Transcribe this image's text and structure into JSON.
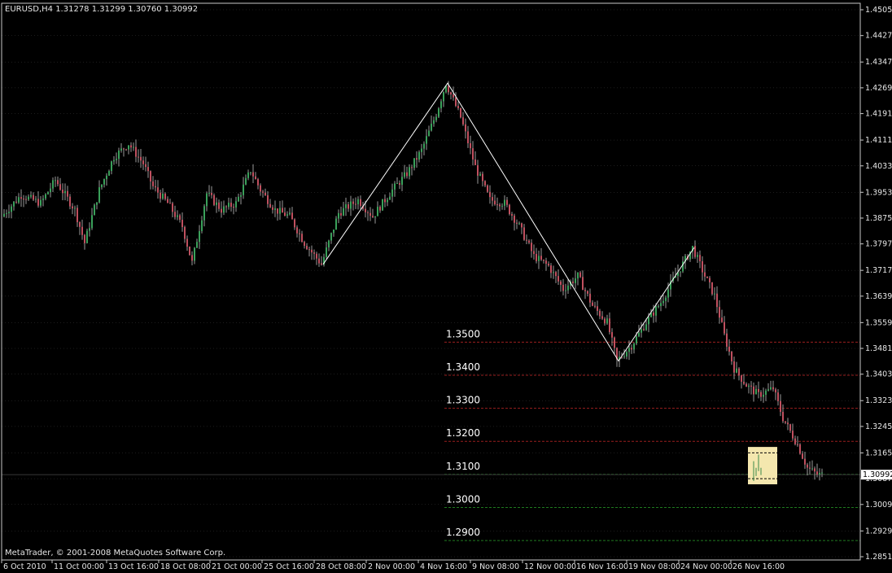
{
  "header": {
    "symbol_info": "EURUSD,H4  1.31278 1.31299 1.30760 1.30992"
  },
  "footer": {
    "copyright": "MetaTrader, © 2001-2008 MetaQuotes Software Corp."
  },
  "colors": {
    "background": "#000000",
    "frame": "#c8c8c8",
    "grid": "#3a3a3a",
    "candle_up": "#3aa05a",
    "candle_down": "#c0505f",
    "wick": "#9a9a9a",
    "zigzag": "#ffffff",
    "level_red": "#9a1f1f",
    "level_green": "#1f7a1f",
    "highlight_box": "#f4e7ae",
    "bid_line": "#4a4a4a"
  },
  "chart_data": {
    "type": "candlestick",
    "symbol": "EURUSD",
    "timeframe": "H4",
    "ohlc_last": {
      "open": 1.31278,
      "high": 1.31299,
      "low": 1.3076,
      "close": 1.30992
    },
    "ylim": [
      1.2851,
      1.4505
    ],
    "y_ticks": [
      "1.45050",
      "1.44270",
      "1.43470",
      "1.42690",
      "1.41910",
      "1.41110",
      "1.40330",
      "1.39530",
      "1.38750",
      "1.37970",
      "1.37170",
      "1.36390",
      "1.35590",
      "1.34810",
      "1.34030",
      "1.33230",
      "1.32450",
      "1.31650",
      "1.30870",
      "1.30090",
      "1.29290",
      "1.28510"
    ],
    "x_ticks": [
      "6 Oct 2010",
      "11 Oct 00:00",
      "13 Oct 16:00",
      "18 Oct 08:00",
      "21 Oct 00:00",
      "25 Oct 16:00",
      "28 Oct 08:00",
      "2 Nov 00:00",
      "4 Nov 16:00",
      "9 Nov 08:00",
      "12 Nov 00:00",
      "16 Nov 16:00",
      "19 Nov 08:00",
      "24 Nov 00:00",
      "26 Nov 16:00"
    ],
    "current_price": "1.30992",
    "levels": [
      {
        "label": "1.3500",
        "value": 1.35,
        "color": "red"
      },
      {
        "label": "1.3400",
        "value": 1.34,
        "color": "red"
      },
      {
        "label": "1.3300",
        "value": 1.33,
        "color": "red"
      },
      {
        "label": "1.3200",
        "value": 1.32,
        "color": "red"
      },
      {
        "label": "1.3100",
        "value": 1.31,
        "color": "green"
      },
      {
        "label": "1.3000",
        "value": 1.3,
        "color": "green"
      },
      {
        "label": "1.2900",
        "value": 1.29,
        "color": "green"
      }
    ],
    "zigzag": [
      {
        "bar": 131,
        "price": 1.3735
      },
      {
        "bar": 182,
        "price": 1.4283
      },
      {
        "bar": 252,
        "price": 1.3443
      },
      {
        "bar": 283,
        "price": 1.3786
      }
    ],
    "highlight_box": {
      "bar_from": 326,
      "bar_to": 340,
      "price_top": 1.3183,
      "price_bottom": 1.307
    },
    "bars": 336
  }
}
